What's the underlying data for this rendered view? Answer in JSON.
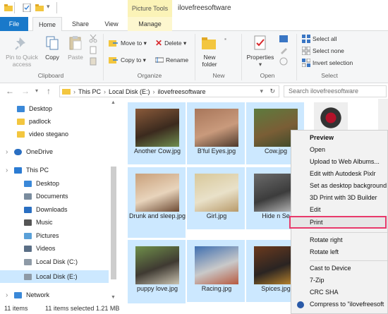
{
  "window": {
    "title": "ilovefreesoftware",
    "context_tab_group": "Picture Tools"
  },
  "tabs": {
    "file": "File",
    "home": "Home",
    "share": "Share",
    "view": "View",
    "manage": "Manage"
  },
  "ribbon": {
    "clipboard": {
      "pin": "Pin to Quick access",
      "copy": "Copy",
      "paste": "Paste",
      "group": "Clipboard"
    },
    "organize": {
      "move_to": "Move to ▾",
      "copy_to": "Copy to ▾",
      "delete": "Delete ▾",
      "rename": "Rename",
      "group": "Organize"
    },
    "new": {
      "new_folder": "New folder",
      "group": "New"
    },
    "open": {
      "properties": "Properties",
      "group": "Open"
    },
    "select": {
      "select_all": "Select all",
      "select_none": "Select none",
      "invert": "Invert selection",
      "group": "Select"
    }
  },
  "address": {
    "this_pc": "This PC",
    "drive": "Local Disk (E:)",
    "folder": "ilovefreesoftware",
    "search_placeholder": "Search ilovefreesoftware"
  },
  "sidebar": {
    "items": [
      "Desktop",
      "padlock",
      "video stegano",
      "OneDrive",
      "This PC",
      "Desktop",
      "Documents",
      "Downloads",
      "Music",
      "Pictures",
      "Videos",
      "Local Disk (C:)",
      "Local Disk (E:)",
      "Network"
    ]
  },
  "files": [
    {
      "name": "Another Cow.jpg"
    },
    {
      "name": "B'ful Eyes.jpg"
    },
    {
      "name": "Cow.jpg"
    },
    {
      "name": "Drunk and sleep.jpg"
    },
    {
      "name": "Girl.jpg"
    },
    {
      "name": "Hide n Se"
    },
    {
      "name": "puppy love.jpg"
    },
    {
      "name": "Racing.jpg"
    },
    {
      "name": "Spices.jpg"
    }
  ],
  "status": {
    "count": "11 items",
    "selected": "11 items selected  1.21 MB"
  },
  "context_menu": {
    "items": [
      "Preview",
      "Open",
      "Upload to Web Albums...",
      "Edit with Autodesk Pixlr",
      "Set as desktop background",
      "3D Print with 3D Builder",
      "Edit",
      "Print",
      "Rotate right",
      "Rotate left",
      "Cast to Device",
      "7-Zip",
      "CRC SHA",
      "Compress to \"ilovefreesoft"
    ]
  },
  "colors": {
    "file_tab": "#1979ca",
    "selection": "#cce8ff",
    "highlight": "#e8396b",
    "context_tab": "#fbf3b7"
  }
}
